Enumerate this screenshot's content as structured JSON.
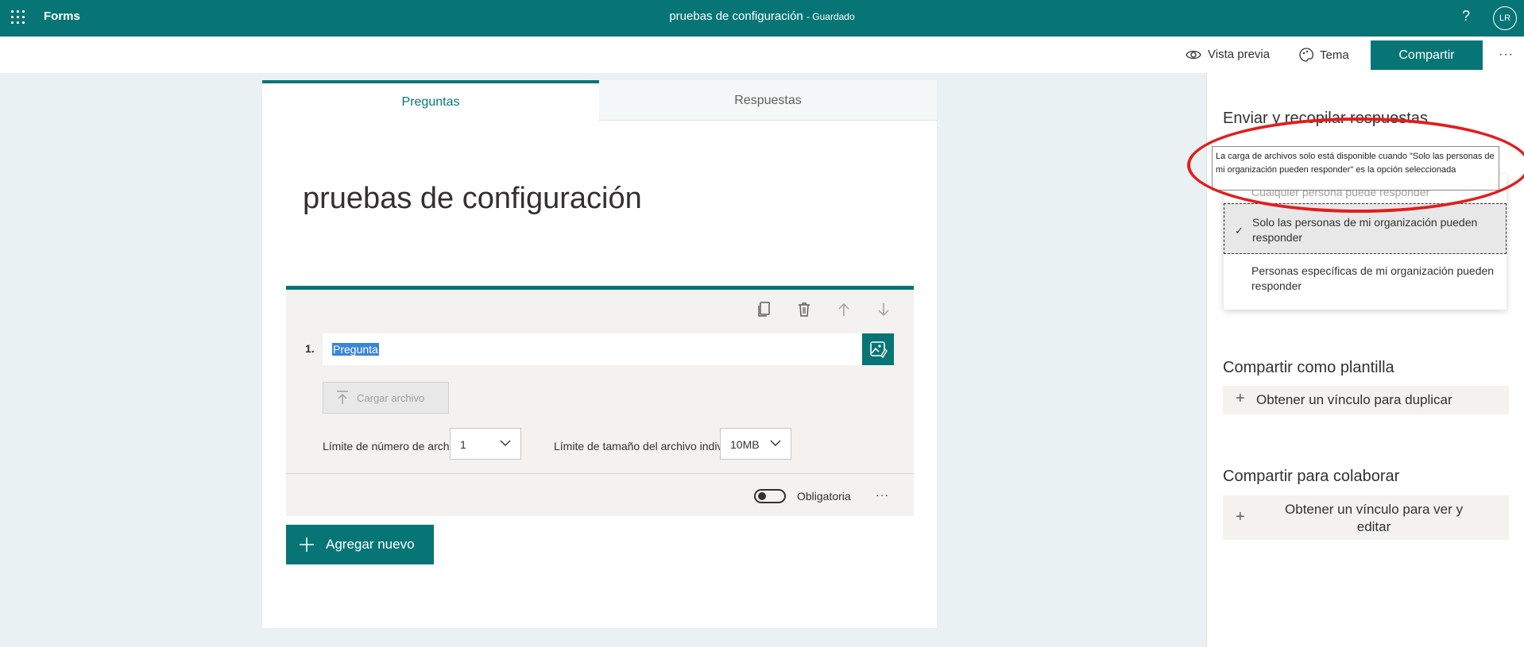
{
  "topbar": {
    "app_name": "Forms",
    "doc_title": "pruebas de configuración",
    "doc_status": "- Guardado",
    "help": "?",
    "avatar_initials": "LR"
  },
  "commandbar": {
    "preview": "Vista previa",
    "theme": "Tema",
    "share": "Compartir",
    "more": "···"
  },
  "tabs": {
    "questions": "Preguntas",
    "responses": "Respuestas"
  },
  "form": {
    "title": "pruebas de configuración",
    "question": {
      "number": "1.",
      "text": "Pregunta",
      "upload_label": "Cargar archivo",
      "file_count_label": "Límite de número de archivos:",
      "file_count_value": "1",
      "file_size_label": "Límite de tamaño del archivo individual:",
      "file_size_value": "10MB",
      "required_label": "Obligatoria",
      "more": "···"
    },
    "add_new": "Agregar nuevo"
  },
  "panel": {
    "send_heading": "Enviar y recopilar respuestas",
    "tooltip": "La carga de archivos solo está disponible cuando \"Solo las personas de mi organización pueden responder\" es la opción seleccionada",
    "options": [
      "Cualquier persona puede responder",
      "Solo las personas de mi organización pueden responder",
      "Personas específicas de mi organización pueden responder"
    ],
    "template_heading": "Compartir como plantilla",
    "template_button": "Obtener un vínculo para duplicar",
    "collab_heading": "Compartir para colaborar",
    "collab_button": "Obtener un vínculo para ver y editar"
  },
  "colors": {
    "brand": "#077575",
    "annotation": "#e11e1e",
    "selection": "#3a85d7"
  }
}
